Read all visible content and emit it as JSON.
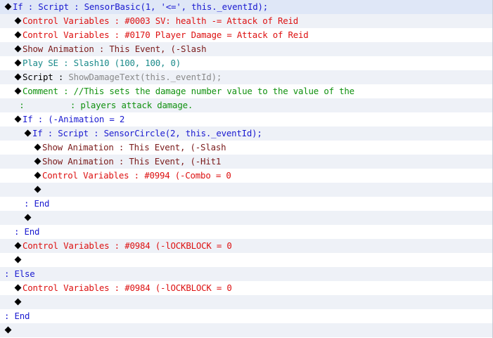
{
  "event_commands": [
    {
      "indent": 0,
      "marker": true,
      "parts": [
        {
          "text": "If : Script : SensorBasic(1, '<=', this._eventId);",
          "color": "blue"
        }
      ]
    },
    {
      "indent": 1,
      "marker": true,
      "parts": [
        {
          "text": "Control Variables : #0003 SV: health -= Attack of Reid",
          "color": "red"
        }
      ]
    },
    {
      "indent": 1,
      "marker": true,
      "parts": [
        {
          "text": "Control Variables : #0170 Player Damage = Attack of Reid",
          "color": "red"
        }
      ]
    },
    {
      "indent": 1,
      "marker": true,
      "parts": [
        {
          "text": "Show Animation : This Event, (-Slash",
          "color": "brown"
        }
      ]
    },
    {
      "indent": 1,
      "marker": true,
      "parts": [
        {
          "text": "Play SE : Slash10 (100, 100, 0)",
          "color": "teal"
        }
      ]
    },
    {
      "indent": 1,
      "marker": true,
      "parts": [
        {
          "text": "Script : ",
          "color": "black"
        },
        {
          "text": "ShowDamageText(this._eventId);",
          "color": "gray"
        }
      ]
    },
    {
      "indent": 1,
      "marker": true,
      "parts": [
        {
          "text": "Comment : //This sets the damage number value to the value of the",
          "color": "green"
        }
      ]
    },
    {
      "indent": 1,
      "marker": false,
      "parts": [
        {
          "text": " :         : players attack damage.",
          "color": "green"
        }
      ]
    },
    {
      "indent": 1,
      "marker": true,
      "parts": [
        {
          "text": "If : (-Animation = 2",
          "color": "blue"
        }
      ]
    },
    {
      "indent": 2,
      "marker": true,
      "parts": [
        {
          "text": "If : Script : SensorCircle(2, this._eventId);",
          "color": "blue"
        }
      ]
    },
    {
      "indent": 3,
      "marker": true,
      "parts": [
        {
          "text": "Show Animation : This Event, (-Slash",
          "color": "brown"
        }
      ]
    },
    {
      "indent": 3,
      "marker": true,
      "parts": [
        {
          "text": "Show Animation : This Event, (-Hit1",
          "color": "brown"
        }
      ]
    },
    {
      "indent": 3,
      "marker": true,
      "parts": [
        {
          "text": "Control Variables : #0994 (-Combo = 0",
          "color": "red"
        }
      ]
    },
    {
      "indent": 3,
      "marker": true,
      "parts": []
    },
    {
      "indent": 2,
      "marker": false,
      "parts": [
        {
          "text": ": End",
          "color": "blue"
        }
      ]
    },
    {
      "indent": 2,
      "marker": true,
      "parts": []
    },
    {
      "indent": 1,
      "marker": false,
      "parts": [
        {
          "text": ": End",
          "color": "blue"
        }
      ]
    },
    {
      "indent": 1,
      "marker": true,
      "parts": [
        {
          "text": "Control Variables : #0984 (-lOCKBLOCK = 0",
          "color": "red"
        }
      ]
    },
    {
      "indent": 1,
      "marker": true,
      "parts": []
    },
    {
      "indent": 0,
      "marker": false,
      "parts": [
        {
          "text": ": Else",
          "color": "blue"
        }
      ]
    },
    {
      "indent": 1,
      "marker": true,
      "parts": [
        {
          "text": "Control Variables : #0984 (-lOCKBLOCK = 0",
          "color": "red"
        }
      ]
    },
    {
      "indent": 1,
      "marker": true,
      "parts": []
    },
    {
      "indent": 0,
      "marker": false,
      "parts": [
        {
          "text": ": End",
          "color": "blue"
        }
      ]
    },
    {
      "indent": 0,
      "marker": true,
      "parts": []
    }
  ]
}
